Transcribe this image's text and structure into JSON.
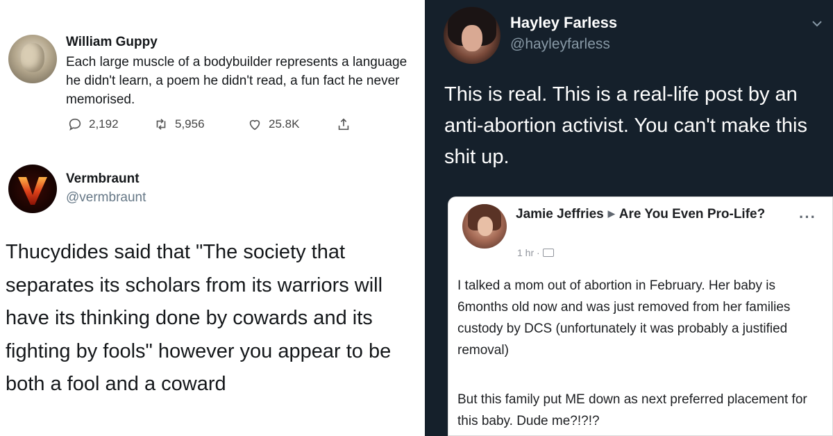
{
  "tweet1": {
    "name": "William Guppy",
    "body": "Each large muscle of a bodybuilder represents a language he didn't learn, a poem he didn't read, a fun fact he never memorised.",
    "replies": "2,192",
    "retweets": "5,956",
    "likes": "25.8K",
    "icons": [
      "reply-icon",
      "retweet-icon",
      "like-icon",
      "share-icon"
    ]
  },
  "tweet2": {
    "name": "Vermbraunt",
    "handle": "@vermbraunt",
    "body": "Thucydides said that \"The society that separates its scholars from its warriors will have its thinking done by cowards and its fighting by fools\" however you appear to be both a fool and a coward"
  },
  "tweet3": {
    "name": "Hayley Farless",
    "handle": "@hayleyfarless",
    "body": "This is real. This is a real-life post by an anti-abortion activist. You can't make this shit up.",
    "icons": [
      "chevron-down-icon"
    ]
  },
  "fb_post": {
    "author": "Jamie Jeffries",
    "group": "Are You Even Pro-Life?",
    "time": "1 hr ·",
    "more": "···",
    "paragraph1": "I talked a mom out of abortion in February. Her baby is 6months old now and was just removed from her families custody by DCS (unfortunately it was probably a justified removal)",
    "paragraph2": "But this family put ME down as next preferred placement for this baby. Dude me?!?!?"
  },
  "colors": {
    "dark_bg": "#15202b",
    "muted_text": "#8899a6",
    "light_text": "#14171a"
  }
}
